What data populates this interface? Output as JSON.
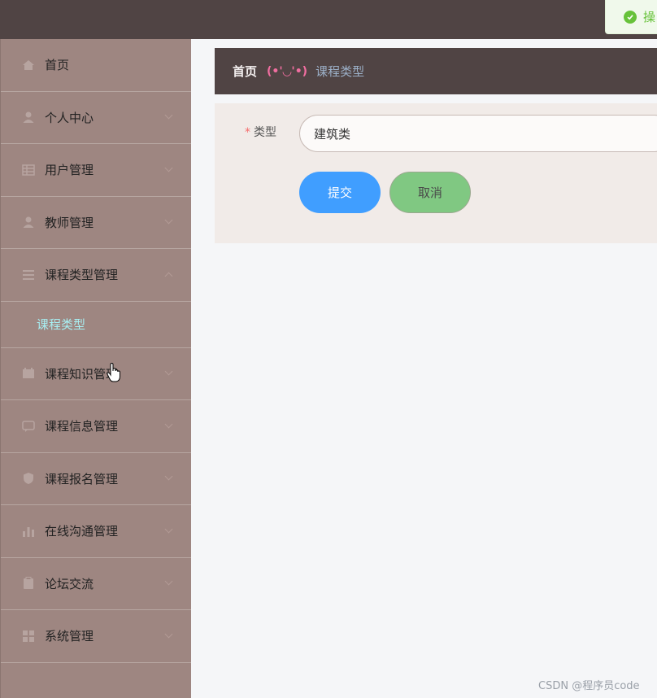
{
  "header": {
    "toast_text": "操"
  },
  "sidebar": {
    "items": [
      {
        "label": "首页",
        "icon": "home-icon",
        "has_arrow": false
      },
      {
        "label": "个人中心",
        "icon": "user-icon",
        "has_arrow": true
      },
      {
        "label": "用户管理",
        "icon": "grid-icon",
        "has_arrow": true
      },
      {
        "label": "教师管理",
        "icon": "person-icon",
        "has_arrow": true
      },
      {
        "label": "课程类型管理",
        "icon": "list-icon",
        "has_arrow": true,
        "expanded": true
      },
      {
        "label": "课程知识管理",
        "icon": "calendar-icon",
        "has_arrow": true
      },
      {
        "label": "课程信息管理",
        "icon": "chat-icon",
        "has_arrow": true
      },
      {
        "label": "课程报名管理",
        "icon": "shield-icon",
        "has_arrow": true
      },
      {
        "label": "在线沟通管理",
        "icon": "bar-chart-icon",
        "has_arrow": true
      },
      {
        "label": "论坛交流",
        "icon": "clipboard-icon",
        "has_arrow": true
      },
      {
        "label": "系统管理",
        "icon": "apps-icon",
        "has_arrow": true
      }
    ],
    "sub_item": "课程类型"
  },
  "breadcrumb": {
    "home": "首页",
    "kaomoji": "(•'◡'•)",
    "current": "课程类型"
  },
  "form": {
    "required_mark": "*",
    "type_label": "类型",
    "type_value": "建筑类",
    "submit_label": "提交",
    "cancel_label": "取消"
  },
  "watermark": "CSDN @程序员code",
  "colors": {
    "topbar": "#504444",
    "sidebar": "#9e8681",
    "active_sub": "#a8f0f3",
    "submit": "#409eff",
    "cancel": "#80c882",
    "success": "#67c23a"
  }
}
